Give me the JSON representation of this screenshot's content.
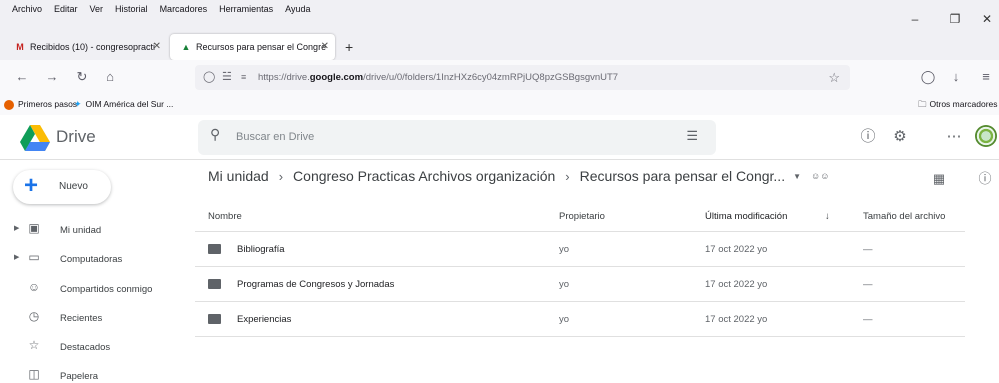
{
  "browser": {
    "menu": [
      "Archivo",
      "Editar",
      "Ver",
      "Historial",
      "Marcadores",
      "Herramientas",
      "Ayuda"
    ],
    "tabs": [
      {
        "title": "Recibidos (10) - congresopracti",
        "icon": "gmail-icon"
      },
      {
        "title": "Recursos para pensar el Congre",
        "icon": "drive-icon"
      }
    ],
    "url_prefix": "https://drive.",
    "url_domain": "google.com",
    "url_path": "/drive/u/0/folders/1InzHXz6cy04zmRPjUQ8pzGSBgsgvnUT7",
    "bookmarks": [
      "Primeros pasos",
      "OIM América del Sur ..."
    ],
    "other_bookmarks": "Otros marcadores"
  },
  "drive": {
    "brand": "Drive",
    "search_placeholder": "Buscar en Drive",
    "new_label": "Nuevo",
    "sidebar": [
      {
        "label": "Mi unidad",
        "icon": "my-drive-icon"
      },
      {
        "label": "Computadoras",
        "icon": "computers-icon"
      },
      {
        "label": "Compartidos conmigo",
        "icon": "shared-icon"
      },
      {
        "label": "Recientes",
        "icon": "clock-icon"
      },
      {
        "label": "Destacados",
        "icon": "star-icon"
      },
      {
        "label": "Papelera",
        "icon": "trash-icon"
      }
    ],
    "breadcrumb": [
      "Mi unidad",
      "Congreso Practicas Archivos organización",
      "Recursos para pensar el Congr..."
    ],
    "columns": {
      "name": "Nombre",
      "owner": "Propietario",
      "modified": "Última modificación",
      "size": "Tamaño del archivo"
    },
    "rows": [
      {
        "name": "Bibliografía",
        "owner": "yo",
        "modified": "17 oct 2022 yo",
        "size": "—"
      },
      {
        "name": "Programas de Congresos y Jornadas",
        "owner": "yo",
        "modified": "17 oct 2022 yo",
        "size": "—"
      },
      {
        "name": "Experiencias",
        "owner": "yo",
        "modified": "17 oct 2022 yo",
        "size": "—"
      }
    ]
  }
}
